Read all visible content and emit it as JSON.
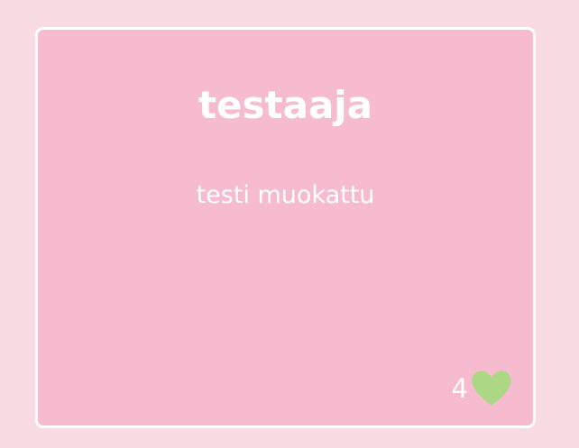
{
  "card": {
    "title": "testaaja",
    "text": "testi muokattu",
    "like_count": "4",
    "like_icon": "heart-icon"
  },
  "colors": {
    "page_background": "#f9dbe3",
    "card_background": "#f7bbcf",
    "card_border": "#ffffff",
    "text": "#ffffff",
    "heart": "#acd884"
  }
}
